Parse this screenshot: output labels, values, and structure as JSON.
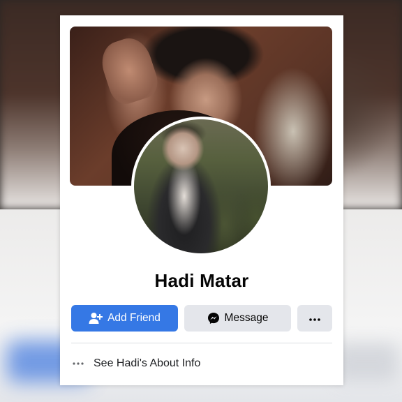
{
  "profile": {
    "name": "Hadi Matar"
  },
  "actions": {
    "add_friend_label": "Add Friend",
    "message_label": "Message",
    "more_label": "···"
  },
  "about": {
    "label": "See Hadi's About Info"
  },
  "colors": {
    "primary_button": "#3578e5",
    "secondary_button": "#e4e6eb",
    "card": "#ffffff",
    "text": "#050505"
  },
  "icons": {
    "add_friend": "person-plus-icon",
    "message": "messenger-icon",
    "more": "more-dots-icon",
    "about": "more-dots-icon"
  }
}
